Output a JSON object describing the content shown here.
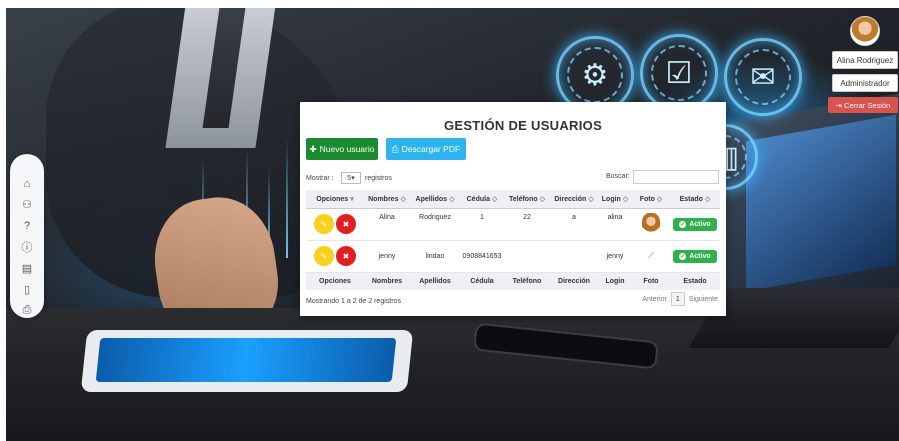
{
  "sidenav": {
    "items": [
      {
        "icon": "home-icon",
        "glyph": "⌂"
      },
      {
        "icon": "users-icon",
        "glyph": "⚇"
      },
      {
        "icon": "help-icon",
        "glyph": "?"
      },
      {
        "icon": "info-icon",
        "glyph": "ⓘ"
      },
      {
        "icon": "archive-icon",
        "glyph": "▤"
      },
      {
        "icon": "phone-icon",
        "glyph": "▯"
      },
      {
        "icon": "printer-icon",
        "glyph": "⎙"
      }
    ]
  },
  "user": {
    "name": "Alina Rodriguez",
    "role": "Administrador",
    "logout": "Cerrar Sesión"
  },
  "panel": {
    "title": "GESTIÓN DE USUARIOS",
    "new_button": "Nuevo usuario",
    "pdf_button": "Descargar PDF"
  },
  "controls": {
    "show_label": "Mostrar :",
    "length_value": "5",
    "records_label": "registros",
    "search_label": "Buscar:",
    "search_value": ""
  },
  "table": {
    "headers": [
      "Opciones",
      "Nombres",
      "Apellidos",
      "Cédula",
      "Teléfono",
      "Dirección",
      "Login",
      "Foto",
      "Estado"
    ],
    "rows": [
      {
        "nombres": "Alina",
        "apellidos": "Rodriguez",
        "cedula": "1",
        "telefono": "22",
        "direccion": "a",
        "login": "alina",
        "estado": "Activo"
      },
      {
        "nombres": "jenny",
        "apellidos": "lindao",
        "cedula": "0908841653",
        "telefono": "",
        "direccion": "",
        "login": "jenny",
        "estado": "Activo"
      }
    ]
  },
  "footer": {
    "info": "Mostrando 1 a 2 de 2 registros",
    "prev": "Anterior",
    "page": "1",
    "next": "Siguiente"
  },
  "colors": {
    "new_button": "#1a8a2e",
    "pdf_button": "#2db3ee",
    "active_badge": "#2eb24b",
    "edit_button": "#f7d21a",
    "delete_button": "#e02020",
    "logout_button": "#d9534f"
  }
}
